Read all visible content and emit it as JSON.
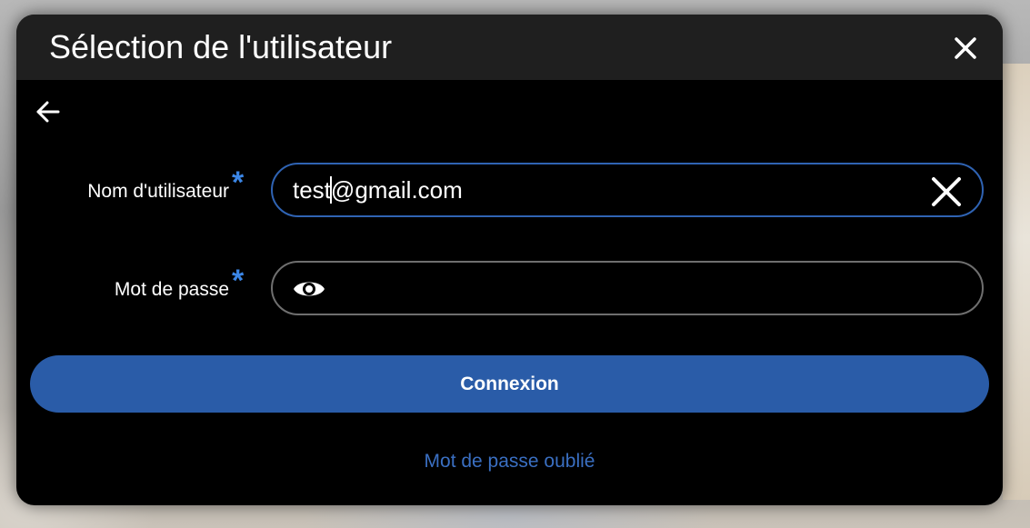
{
  "dialog": {
    "title": "Sélection de l'utilisateur"
  },
  "form": {
    "username": {
      "label": "Nom d'utilisateur",
      "required_mark": "*",
      "value_before_caret": "test",
      "value_after_caret": "@gmail.com"
    },
    "password": {
      "label": "Mot de passe",
      "required_mark": "*",
      "value": ""
    },
    "submit_label": "Connexion",
    "forgot_label": "Mot de passe oublié"
  },
  "colors": {
    "accent": "#2a5ca8",
    "required": "#3b86e6",
    "link": "#3a6fc2",
    "focus_border": "#2f63b3"
  },
  "icons": {
    "close": "close-icon",
    "back": "arrow-left-icon",
    "clear": "clear-icon",
    "reveal": "eye-icon"
  }
}
